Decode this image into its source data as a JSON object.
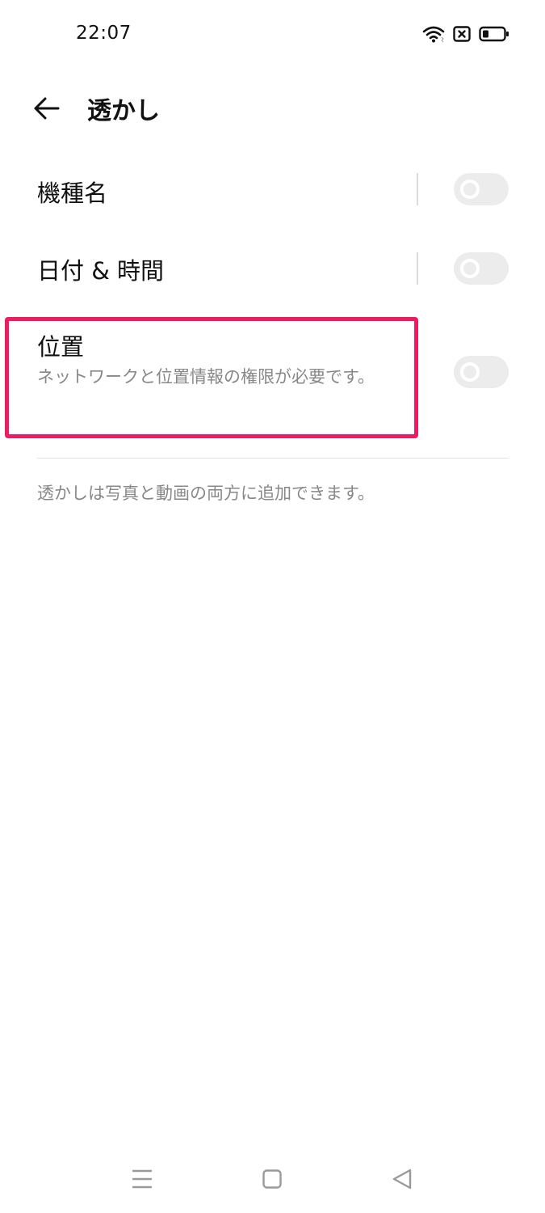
{
  "status_bar": {
    "time": "22:07"
  },
  "header": {
    "title": "透かし"
  },
  "rows": [
    {
      "label": "機種名",
      "enabled": false
    },
    {
      "label": "日付 & 時間",
      "enabled": false
    },
    {
      "label": "位置",
      "subtitle": "ネットワークと位置情報の権限が必要です。",
      "enabled": false
    }
  ],
  "footnote": "透かしは写真と動画の両方に追加できます。",
  "icons": {
    "back": "arrow-left-icon",
    "wifi": "wifi-icon",
    "sim": "no-sim-icon",
    "battery": "battery-icon",
    "nav_menu": "menu-icon",
    "nav_home": "home-icon",
    "nav_back": "back-triangle-icon"
  },
  "colors": {
    "highlight": "#ec1c63",
    "toggle_off": "#ececec",
    "subtitle": "#888888"
  }
}
